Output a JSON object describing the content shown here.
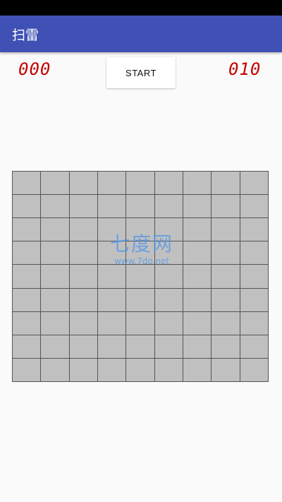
{
  "app": {
    "title": "扫雷"
  },
  "toolbar": {
    "mine_count": "000",
    "start_label": "START",
    "timer": "010"
  },
  "board": {
    "rows": 9,
    "cols": 9,
    "cell_state": "covered"
  },
  "watermark": {
    "main": "七度网",
    "url": "www.7do.net"
  },
  "colors": {
    "app_bar": "#3f51b5",
    "counter_text": "#c40000",
    "cell_covered": "#c0c0c0",
    "background": "#fafafa"
  }
}
